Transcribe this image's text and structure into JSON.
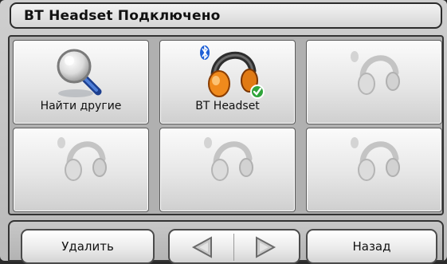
{
  "header": {
    "title": "BT Headset Подключено"
  },
  "tiles": [
    {
      "label": "Найти другие",
      "icon": "magnifier-icon",
      "state": "active"
    },
    {
      "label": "BT Headset",
      "icon": "headset-connected-icon",
      "state": "connected"
    },
    {
      "label": "",
      "icon": "headset-empty-icon",
      "state": "empty"
    },
    {
      "label": "",
      "icon": "headset-empty-icon",
      "state": "empty"
    },
    {
      "label": "",
      "icon": "headset-empty-icon",
      "state": "empty"
    },
    {
      "label": "",
      "icon": "headset-empty-icon",
      "state": "empty"
    }
  ],
  "toolbar": {
    "delete_label": "Удалить",
    "back_label": "Назад",
    "prev_icon": "arrow-left-icon",
    "next_icon": "arrow-right-icon"
  },
  "colors": {
    "bluetooth": "#1e5fd6",
    "check": "#2fa43a",
    "headset_orange": "#f08a1c",
    "headset_gray": "#c9c9c9"
  }
}
